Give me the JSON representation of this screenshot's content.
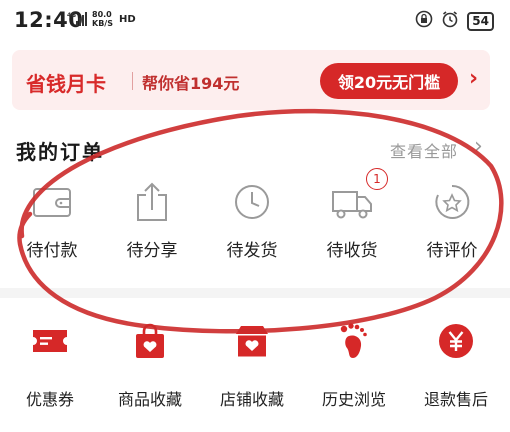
{
  "status_bar": {
    "time": "12:40",
    "net_speed_value": "80.0",
    "net_speed_unit": "KB/S",
    "hd": "HD",
    "signal": "4G",
    "battery": "54"
  },
  "banner": {
    "title": "省钱月卡",
    "subtitle": "帮你省194元",
    "button": "领20元无门槛",
    "arrow": "›"
  },
  "orders": {
    "title": "我的订单",
    "view_all": "查看全部",
    "items": [
      {
        "label": "待付款",
        "icon": "wallet-icon"
      },
      {
        "label": "待分享",
        "icon": "share-icon"
      },
      {
        "label": "待发货",
        "icon": "clock-icon"
      },
      {
        "label": "待收货",
        "icon": "truck-icon",
        "badge": "1"
      },
      {
        "label": "待评价",
        "icon": "review-star-icon"
      }
    ]
  },
  "tools": {
    "items": [
      {
        "label": "优惠券",
        "icon": "coupon-icon"
      },
      {
        "label": "商品收藏",
        "icon": "bag-heart-icon"
      },
      {
        "label": "店铺收藏",
        "icon": "shop-heart-icon"
      },
      {
        "label": "历史浏览",
        "icon": "footprint-icon"
      },
      {
        "label": "退款售后",
        "icon": "yuan-refund-icon"
      }
    ]
  },
  "colors": {
    "accent": "#d62828",
    "banner_bg": "#fdeeee",
    "annotation": "#cc2a2a"
  }
}
